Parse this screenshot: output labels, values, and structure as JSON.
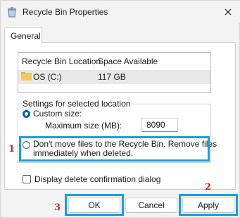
{
  "window": {
    "title": "Recycle Bin Properties",
    "close_glyph": "✕"
  },
  "tabs": [
    {
      "label": "General",
      "active": true
    }
  ],
  "locations_table": {
    "headers": [
      "Recycle Bin Location",
      "Space Available"
    ],
    "rows": [
      {
        "location": "OS (C:)",
        "space": "117 GB",
        "icon": "folder-icon",
        "selected": true
      }
    ]
  },
  "settings": {
    "group_label": "Settings for selected location",
    "custom_size_label": "Custom size:",
    "max_size_label": "Maximum size (MB):",
    "max_size_value": "8090",
    "dont_move_line1": "Don't move files to the Recycle Bin. Remove files",
    "dont_move_line2": "immediately when deleted."
  },
  "confirm_dialog_label": "Display delete confirmation dialog",
  "buttons": {
    "ok": "OK",
    "cancel": "Cancel",
    "apply": "Apply"
  },
  "annotations": {
    "marker_1": "1",
    "marker_2": "2",
    "marker_3": "3",
    "highlight_color": "#1a9fe0",
    "marker_color": "#d61f1f"
  },
  "colors": {
    "accent": "#005fb8",
    "window_bg": "#f3f3f3",
    "folder": "#e8b84a"
  }
}
